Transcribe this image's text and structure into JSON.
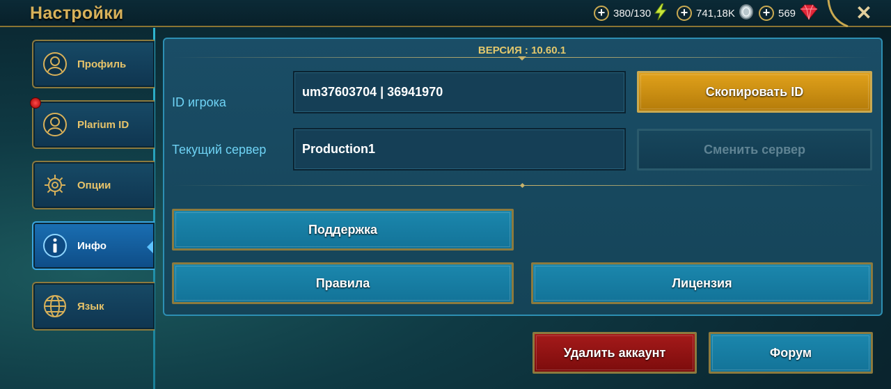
{
  "header": {
    "title": "Настройки",
    "energy": "380/130",
    "silver": "741,18K",
    "gems": "569",
    "close_label": "✕"
  },
  "sidebar": {
    "items": [
      {
        "label": "Профиль",
        "icon": "profile-icon"
      },
      {
        "label": "Plarium ID",
        "icon": "plarium-id-icon",
        "notification": true
      },
      {
        "label": "Опции",
        "icon": "gear-icon"
      },
      {
        "label": "Инфо",
        "icon": "info-icon",
        "active": true
      },
      {
        "label": "Язык",
        "icon": "globe-icon"
      }
    ]
  },
  "main": {
    "version": "ВЕРСИЯ : 10.60.1",
    "player_id_label": "ID игрока",
    "player_id_value": "um37603704 | 36941970",
    "copy_id_label": "Скопировать ID",
    "server_label": "Текущий сервер",
    "server_value": "Production1",
    "change_server_label": "Сменить сервер",
    "support_label": "Поддержка",
    "rules_label": "Правила",
    "license_label": "Лицензия",
    "delete_account_label": "Удалить аккаунт",
    "forum_label": "Форум"
  },
  "colors": {
    "accent_gold": "#d8b15a",
    "label_cyan": "#6fd3f5",
    "button_blue": "#1b87ad",
    "button_red": "#a51a1a",
    "button_gold": "#e0a11b"
  }
}
